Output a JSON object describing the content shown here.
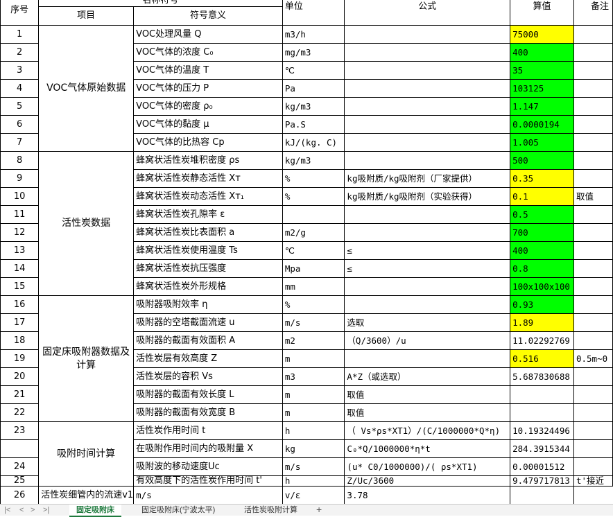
{
  "header": {
    "top_partial": "名称符号",
    "col_index": "序号",
    "col_item": "项目",
    "col_meaning": "符号意义",
    "col_unit": "单位",
    "col_formula": "公式",
    "col_value": "算值",
    "col_note": "备注"
  },
  "groups": {
    "g1": "VOC气体原始数据",
    "g2": "活性炭数据",
    "g3": "固定床吸附器数据及计算",
    "g4": "吸附时间计算"
  },
  "rows": [
    {
      "n": "1",
      "meaning": "VOC处理风量 Q",
      "unit": "m3/h",
      "formula": "",
      "value": "75000",
      "note": ""
    },
    {
      "n": "2",
      "meaning": "VOC气体的浓度 C₀",
      "unit": "mg/m3",
      "formula": "",
      "value": "400",
      "note": ""
    },
    {
      "n": "3",
      "meaning": "VOC气体的温度 T",
      "unit": "℃",
      "formula": "",
      "value": "35",
      "note": ""
    },
    {
      "n": "4",
      "meaning": "VOC气体的压力 P",
      "unit": "Pa",
      "formula": "",
      "value": "103125",
      "note": ""
    },
    {
      "n": "5",
      "meaning": "VOC气体的密度 ρ₀",
      "unit": "kg/m3",
      "formula": "",
      "value": "1.147",
      "note": ""
    },
    {
      "n": "6",
      "meaning": "VOC气体的黏度 μ",
      "unit": "Pa.S",
      "formula": "",
      "value": "0.0000194",
      "note": ""
    },
    {
      "n": "7",
      "meaning": "VOC气体的比热容 Cp",
      "unit": "kJ/(kg. C)",
      "formula": "",
      "value": "1.005",
      "note": ""
    },
    {
      "n": "8",
      "meaning": "蜂窝状活性炭堆积密度 ρs",
      "unit": "kg/m3",
      "formula": "",
      "value": "500",
      "note": ""
    },
    {
      "n": "9",
      "meaning": "蜂窝状活性炭静态活性 Xт",
      "unit": "%",
      "formula": "kg吸附质/kg吸附剂（厂家提供）",
      "value": "0.35",
      "note": ""
    },
    {
      "n": "10",
      "meaning": "蜂窝状活性炭动态活性 Xт₁",
      "unit": "%",
      "formula": "kg吸附质/kg吸附剂（实验获得）",
      "value": "0.1",
      "note": "取值"
    },
    {
      "n": "11",
      "meaning": "蜂窝状活性炭孔隙率 ε",
      "unit": "",
      "formula": "",
      "value": "0.5",
      "note": ""
    },
    {
      "n": "12",
      "meaning": "蜂窝状活性炭比表面积 a",
      "unit": "m2/g",
      "formula": "",
      "value": "700",
      "note": ""
    },
    {
      "n": "13",
      "meaning": "蜂窝状活性炭使用温度 Ts",
      "unit": "℃",
      "formula": "≤",
      "value": "400",
      "note": ""
    },
    {
      "n": "14",
      "meaning": "蜂窝状活性炭抗压强度",
      "unit": "Mpa",
      "formula": "≤",
      "value": "0.8",
      "note": ""
    },
    {
      "n": "15",
      "meaning": "蜂窝状活性炭外形规格",
      "unit": "mm",
      "formula": "",
      "value": "100x100x100",
      "note": ""
    },
    {
      "n": "16",
      "meaning": "吸附器吸附效率 η",
      "unit": "%",
      "formula": "",
      "value": "0.93",
      "note": ""
    },
    {
      "n": "17",
      "meaning": "吸附器的空塔截面流速 u",
      "unit": "m/s",
      "formula": "选取",
      "value": "1.89",
      "note": ""
    },
    {
      "n": "18",
      "meaning": "吸附器的截面有效面积 A",
      "unit": "m2",
      "formula": "（Q/3600）/u",
      "value": "11.02292769",
      "note": ""
    },
    {
      "n": "19",
      "meaning": "活性炭层有效高度 Z",
      "unit": "m",
      "formula": "",
      "value": "0.516",
      "note": "0.5m~0"
    },
    {
      "n": "20",
      "meaning": "活性炭层的容积 Vs",
      "unit": "m3",
      "formula": "A*Z（或选取）",
      "value": "5.687830688",
      "note": ""
    },
    {
      "n": "21",
      "meaning": "吸附器的截面有效长度 L",
      "unit": "m",
      "formula": "取值",
      "value": "",
      "note": ""
    },
    {
      "n": "22",
      "meaning": "吸附器的截面有效宽度 B",
      "unit": "m",
      "formula": "取值",
      "value": "",
      "note": ""
    },
    {
      "n": "23",
      "meaning": "活性炭作用时间 t",
      "unit": "h",
      "formula": "（ Vs*ρs*XT1）/(C/1000000*Q*η)",
      "value": "10.19324496",
      "note": ""
    },
    {
      "n": "",
      "meaning": "在吸附作用时间内的吸附量 X",
      "unit": "kg",
      "formula": "C₀*Q/1000000*η*t",
      "value": "284.3915344",
      "note": ""
    },
    {
      "n": "24",
      "meaning": "吸附波的移动速度Uc",
      "unit": "m/s",
      "formula": "(u* C0/1000000)/( ρs*XT1)",
      "value": "0.00001512",
      "note": ""
    },
    {
      "n": "25",
      "meaning": "有效高度下的活性炭作用时间 t'",
      "unit": "h",
      "formula": "Z/Uc/3600",
      "value": "9.479717813",
      "note": "t'接近"
    },
    {
      "n": "26",
      "meaning": "活性炭细管内的流速v1",
      "unit": "m/s",
      "formula": "v/ε",
      "value": "3.78",
      "note": ""
    }
  ],
  "tabs": {
    "t1": "固定吸附床",
    "t2": "固定吸附床(宁波太平)",
    "t3": "活性炭吸附计算",
    "add": "+"
  },
  "colors": {
    "yellow": "#ffff00",
    "green": "#00ff00",
    "active_tab": "#1f7a3e"
  }
}
